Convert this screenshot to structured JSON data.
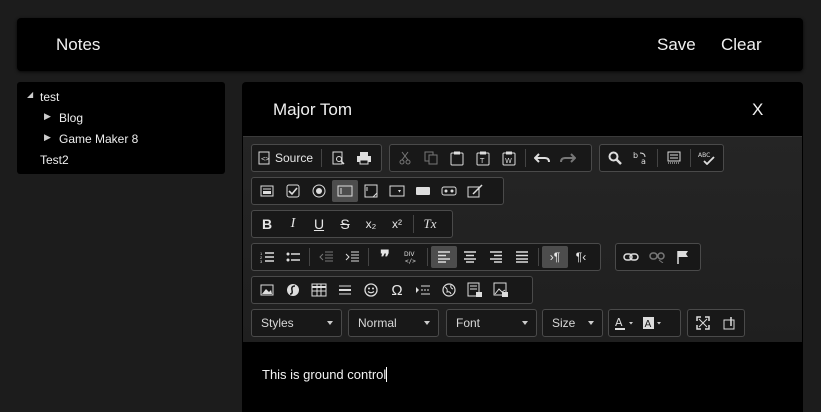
{
  "header": {
    "title": "Notes",
    "save_label": "Save",
    "clear_label": "Clear"
  },
  "tree": {
    "root": {
      "label": "test",
      "expanded": true,
      "children": [
        {
          "label": "Blog",
          "collapsed": true
        },
        {
          "label": "Game Maker 8",
          "collapsed": true
        }
      ]
    },
    "second": {
      "label": "Test2"
    }
  },
  "editor": {
    "title": "Major Tom",
    "close_label": "X",
    "source_label": "Source",
    "combos": {
      "styles": "Styles",
      "format": "Normal",
      "font": "Font",
      "size": "Size"
    },
    "bold": "B",
    "italic": "I",
    "underline": "U",
    "strike": "S",
    "subscript": "x₂",
    "superscript": "x²",
    "remove_format": "Tx",
    "content_text": "This is ground control"
  }
}
